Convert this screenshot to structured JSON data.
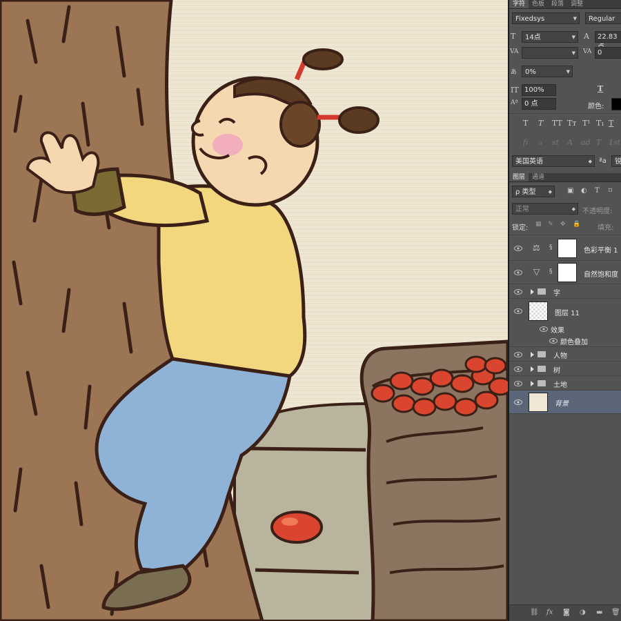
{
  "panel": {
    "tabs": [
      "字符",
      "色板",
      "段落",
      "调整"
    ],
    "font_family": "Fixedsys",
    "font_style": "Regular",
    "font_size": "14点",
    "leading": "22.83 点",
    "kerning": "",
    "tracking": "0",
    "tsume": "0%",
    "vertical_scale": "100%",
    "horizontal_scale_icon": "T",
    "baseline_shift": "0 点",
    "color_label": "颜色:",
    "language": "美国英语",
    "aa_label": "ªa",
    "aa_value": "锐",
    "type_buttons": [
      "T",
      "T",
      "TT",
      "Tт",
      "T¹",
      "T₁",
      "T",
      "T"
    ],
    "opentype_buttons": [
      "fi",
      "ℴ",
      "st",
      "A",
      "ad",
      "T",
      "1st"
    ]
  },
  "layers_panel": {
    "tabs": [
      "图层",
      "通道"
    ],
    "filter_label": "ρ 类型",
    "blend_mode": "正常",
    "opacity_label": "不透明度:",
    "lock_label": "锁定:",
    "fill_label": "填充:",
    "layers": [
      {
        "name": "色彩平衡 1",
        "kind": "adjustment-balance",
        "icon": "scale-icon"
      },
      {
        "name": "自然饱和度",
        "kind": "adjustment-vibrance",
        "icon": "triangle-icon"
      },
      {
        "name": "字",
        "kind": "group"
      },
      {
        "name": "图层 11",
        "kind": "pixel"
      },
      {
        "name": "效果",
        "kind": "effects"
      },
      {
        "name": "颜色叠加",
        "kind": "effect"
      },
      {
        "name": "人物",
        "kind": "group"
      },
      {
        "name": "树",
        "kind": "group"
      },
      {
        "name": "土地",
        "kind": "group"
      },
      {
        "name": "背景",
        "kind": "background",
        "selected": true
      }
    ],
    "bottom_icons": [
      "link-icon",
      "fx-icon",
      "mask-icon",
      "adjustment-icon",
      "folder-icon",
      "trash-icon"
    ],
    "fx_text": "fx"
  },
  "colors": {
    "panel_bg": "#535353",
    "selected_layer": "#5a6578",
    "canvas_bg": "#efe7d4",
    "tree": "#9c7555",
    "shirt": "#f2d77e",
    "pants": "#8fb3d6",
    "dates": "#d9452e"
  }
}
